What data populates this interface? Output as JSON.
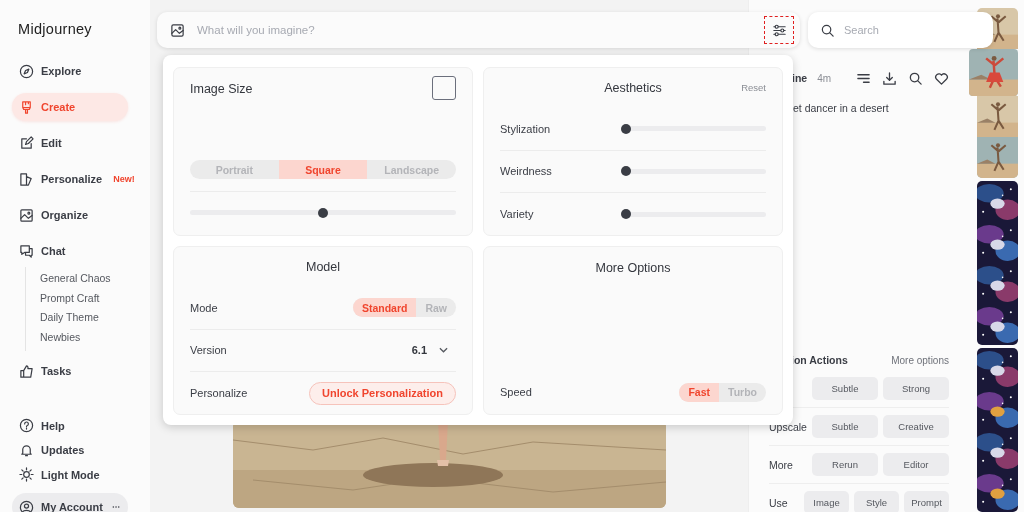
{
  "sidebar": {
    "logo": "Midjourney",
    "items": [
      {
        "label": "Explore",
        "selected": false
      },
      {
        "label": "Create",
        "selected": true
      },
      {
        "label": "Edit",
        "selected": false
      },
      {
        "label": "Personalize",
        "selected": false,
        "badge": "New!"
      },
      {
        "label": "Organize",
        "selected": false
      },
      {
        "label": "Chat",
        "selected": false,
        "children": [
          {
            "label": "General Chaos"
          },
          {
            "label": "Prompt Craft"
          },
          {
            "label": "Daily Theme"
          },
          {
            "label": "Newbies"
          }
        ]
      },
      {
        "label": "Tasks",
        "selected": false
      }
    ],
    "footer": [
      {
        "label": "Help"
      },
      {
        "label": "Updates"
      },
      {
        "label": "Light Mode"
      }
    ],
    "account": {
      "label": "My Account"
    }
  },
  "prompt_bar": {
    "placeholder": "What will you imagine?"
  },
  "search": {
    "placeholder": "Search"
  },
  "settings": {
    "image_size": {
      "title": "Image Size",
      "options": [
        {
          "label": "Portrait",
          "selected": false
        },
        {
          "label": "Square",
          "selected": true
        },
        {
          "label": "Landscape",
          "selected": false
        }
      ],
      "level": 0.5
    },
    "aesthetics": {
      "title": "Aesthetics",
      "reset": "Reset",
      "sliders": [
        {
          "label": "Stylization",
          "level": 0
        },
        {
          "label": "Weirdness",
          "level": 0
        },
        {
          "label": "Variety",
          "level": 0
        }
      ]
    },
    "model": {
      "title": "Model",
      "mode": {
        "label": "Mode",
        "options": [
          {
            "label": "Standard",
            "selected": true
          },
          {
            "label": "Raw",
            "selected": false
          }
        ]
      },
      "version": {
        "label": "Version",
        "value": "6.1"
      },
      "personalize": {
        "label": "Personalize",
        "button": "Unlock Personalization"
      }
    },
    "more_options": {
      "title": "More Options",
      "speed": {
        "label": "Speed",
        "options": [
          {
            "label": "Fast",
            "selected": true
          },
          {
            "label": "Turbo",
            "selected": false
          }
        ]
      }
    }
  },
  "detail": {
    "author": "ine",
    "age": "4m",
    "prompt": "et dancer in a desert",
    "actions_title": "ion Actions",
    "more_options": "More options",
    "rows": [
      {
        "buttons": [
          "Subtle",
          "Strong"
        ]
      },
      {
        "label": "Upscale",
        "buttons": [
          "Subtle",
          "Creative"
        ]
      },
      {
        "label": "More",
        "buttons": [
          "Rerun",
          "Editor"
        ]
      },
      {
        "label": "Use",
        "buttons": [
          "Image",
          "Style",
          "Prompt"
        ]
      }
    ]
  }
}
